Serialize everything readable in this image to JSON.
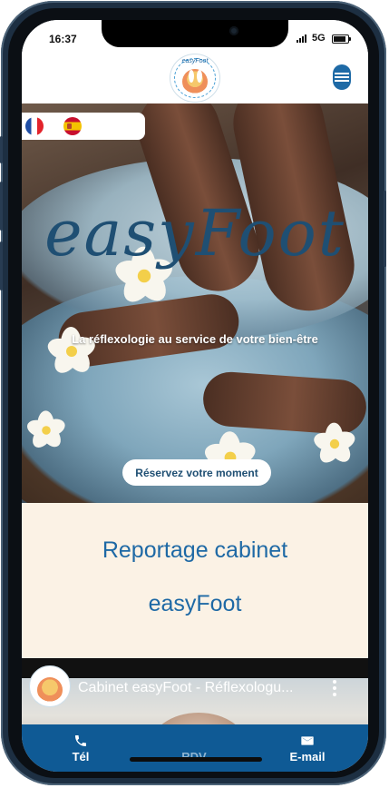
{
  "status_bar": {
    "time": "16:37",
    "network": "5G"
  },
  "header": {
    "logo_text": "easyFoot",
    "menu_icon": "hamburger-menu-icon"
  },
  "languages": [
    {
      "name": "French",
      "icon": "flag-france-icon"
    },
    {
      "name": "Spanish",
      "icon": "flag-spain-icon"
    }
  ],
  "hero": {
    "title": "easyFoot",
    "tagline": "La réflexologie au service de votre bien-être",
    "cta_label": "Réservez votre moment",
    "slide_count": 4
  },
  "report": {
    "line1": "Reportage cabinet",
    "line2": "easyFoot"
  },
  "video": {
    "title": "Cabinet easyFoot - Réflexologu..."
  },
  "bottom_nav": {
    "tel_label": "Tél",
    "rdv_label": "RDV",
    "email_label": "E-mail"
  },
  "colors": {
    "brand_blue": "#1e69a5",
    "bottom_bar": "#0f5a95",
    "report_bg": "#fbf2e5"
  }
}
